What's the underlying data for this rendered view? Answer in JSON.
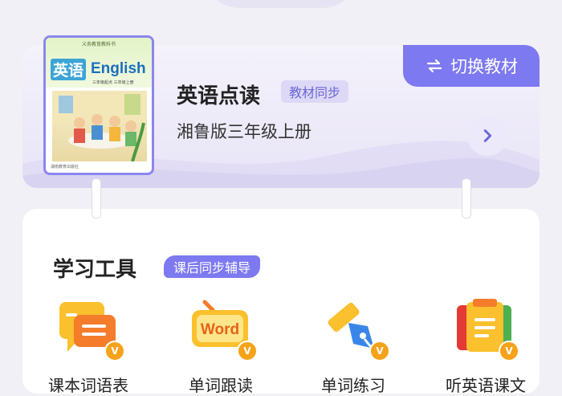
{
  "book": {
    "switch_label": "切换教材",
    "title": "英语点读",
    "badge": "教材同步",
    "subtitle": "湘鲁版三年级上册",
    "cover": {
      "publisher_line": "义务教育教科书",
      "title_cn": "英语",
      "title_en": "English",
      "grade_line": "三年级起点  三年级上册",
      "footer_line": "湖南教育出版社"
    }
  },
  "tools": {
    "title": "学习工具",
    "badge": "课后同步辅导",
    "items": [
      {
        "label": "课本词语表",
        "icon": "vocabulary-list-icon"
      },
      {
        "label": "单词跟读",
        "icon": "word-follow-read-icon",
        "icon_text": "Word"
      },
      {
        "label": "单词练习",
        "icon": "word-practice-icon"
      },
      {
        "label": "听英语课文",
        "icon": "listen-text-icon"
      }
    ],
    "vip_mark": "V"
  },
  "colors": {
    "accent": "#7d79f0",
    "vip": "#f6a21a"
  }
}
